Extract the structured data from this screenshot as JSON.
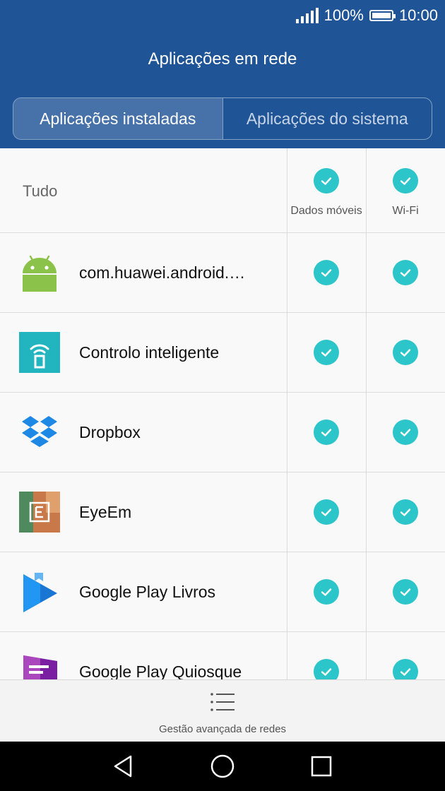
{
  "status": {
    "battery_text": "100%",
    "time": "10:00"
  },
  "header": {
    "title": "Aplicações em rede"
  },
  "tabs": [
    {
      "label": "Aplicações instaladas",
      "active": true
    },
    {
      "label": "Aplicações do sistema",
      "active": false
    }
  ],
  "table": {
    "all_label": "Tudo",
    "columns": [
      "Dados móveis",
      "Wi-Fi"
    ],
    "apps": [
      {
        "name": "com.huawei.android.…",
        "icon": "android-icon",
        "mobile_data": true,
        "wifi": true
      },
      {
        "name": "Controlo inteligente",
        "icon": "smart-control-icon",
        "mobile_data": true,
        "wifi": true
      },
      {
        "name": "Dropbox",
        "icon": "dropbox-icon",
        "mobile_data": true,
        "wifi": true
      },
      {
        "name": "EyeEm",
        "icon": "eyeem-icon",
        "mobile_data": true,
        "wifi": true
      },
      {
        "name": "Google Play Livros",
        "icon": "play-books-icon",
        "mobile_data": true,
        "wifi": true
      },
      {
        "name": "Google Play Quiosque",
        "icon": "play-newsstand-icon",
        "mobile_data": true,
        "wifi": true
      }
    ]
  },
  "bottom": {
    "label": "Gestão avançada de redes"
  },
  "colors": {
    "header": "#1f5497",
    "check": "#2cc5c9"
  }
}
